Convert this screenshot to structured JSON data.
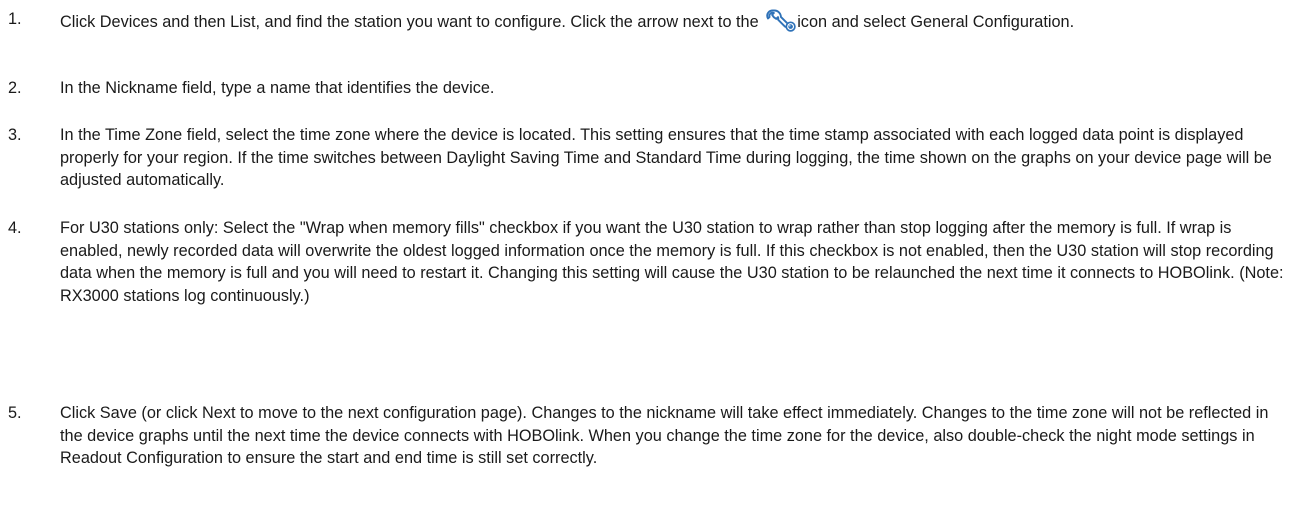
{
  "steps": [
    {
      "number": "1.",
      "text_before_icon": "Click Devices and then List, and find the station you want to configure. Click the arrow next to the ",
      "icon": "wrench-icon",
      "text_after_icon": "icon and select General Configuration."
    },
    {
      "number": "2.",
      "text": "In the Nickname field, type a name that identifies the device."
    },
    {
      "number": "3.",
      "text": "In the Time Zone field, select the time zone where the device is located. This setting ensures that the time stamp associated with each logged data point is displayed properly for your region. If the time switches between Daylight Saving Time and Standard Time during logging, the time shown on the graphs on your device page will be adjusted automatically."
    },
    {
      "number": "4.",
      "text": "For U30 stations only: Select the \"Wrap when memory fills\" checkbox if you want the U30 station to wrap rather than stop logging after the memory is full. If wrap is enabled, newly recorded data will overwrite the oldest logged information once the memory is full. If this checkbox is not enabled, then the U30 station will stop recording data when the memory is full and you will need to restart it. Changing this setting will cause the U30 station to be relaunched the next time it connects to HOBOlink. (Note: RX3000 stations log continuously.)"
    },
    {
      "number": "5.",
      "text": "Click Save (or click Next to move to the next configuration page). Changes to the nickname will take effect immediately. Changes to the time zone will not be reflected in the device graphs until the next time the device connects with HOBOlink. When you change the time zone for the device, also double-check the night mode settings in Readout Configuration to ensure the start and end time is still set correctly."
    }
  ],
  "colors": {
    "text": "#1a1a1a",
    "icon": "#2f72b8"
  }
}
